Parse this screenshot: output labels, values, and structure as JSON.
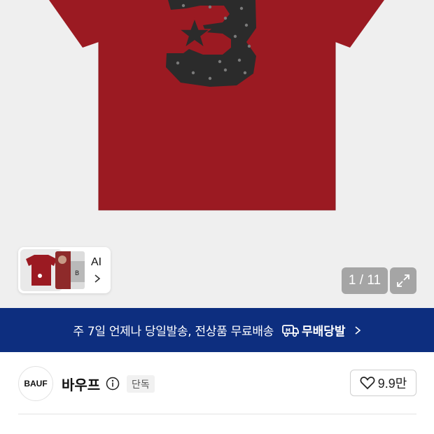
{
  "gallery": {
    "ai_label": "AI",
    "page_counter": "1 / 11"
  },
  "banner": {
    "text": "주 7일 언제나 당일발송, 전상품 무료배송",
    "brand": "무배당발",
    "background_color": "#0d2e7f"
  },
  "brand": {
    "logo_text": "BAUF",
    "name": "바우프",
    "badge": "단독",
    "likes": "9.9만"
  },
  "colors": {
    "shirt": "#9b1a22",
    "patch": "#2b2b2b"
  },
  "icons": {
    "info": "info-icon",
    "heart": "heart-icon",
    "expand": "expand-icon",
    "chevron": "chevron-right-icon",
    "truck": "truck-logo-icon"
  }
}
